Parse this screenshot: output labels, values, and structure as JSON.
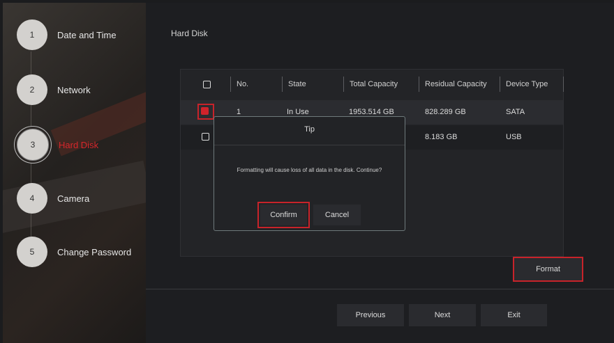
{
  "steps": [
    {
      "number": "1",
      "label": "Date and Time"
    },
    {
      "number": "2",
      "label": "Network"
    },
    {
      "number": "3",
      "label": "Hard Disk"
    },
    {
      "number": "4",
      "label": "Camera"
    },
    {
      "number": "5",
      "label": "Change Password"
    }
  ],
  "page": {
    "title": "Hard Disk"
  },
  "table": {
    "headers": [
      "No.",
      "State",
      "Total Capacity",
      "Residual Capacity",
      "Device Type"
    ],
    "rows": [
      {
        "no": "1",
        "state": "In Use",
        "total": "1953.514 GB",
        "residual": "828.289 GB",
        "type": "SATA"
      },
      {
        "no": "",
        "state": "",
        "total": "",
        "residual": "8.183 GB",
        "type": "USB"
      }
    ]
  },
  "dialog": {
    "title": "Tip",
    "message": "Formatting will cause loss of all data in the disk. Continue?",
    "confirm": "Confirm",
    "cancel": "Cancel"
  },
  "buttons": {
    "format": "Format",
    "previous": "Previous",
    "next": "Next",
    "exit": "Exit"
  },
  "colors": {
    "accent": "#d0232b",
    "background": "#1d1e21"
  }
}
